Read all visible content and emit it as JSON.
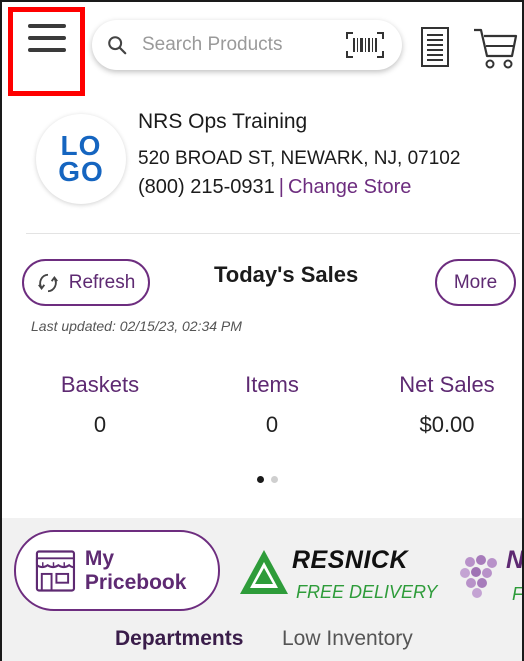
{
  "header": {
    "search": {
      "placeholder": "Search Products"
    }
  },
  "store": {
    "logo": {
      "line1": "LO",
      "line2": "GO"
    },
    "name": "NRS Ops Training",
    "address": "520 BROAD ST,  NEWARK,  NJ, 07102",
    "phone": "(800) 215-0931",
    "divider": "|",
    "change_store_label": "Change Store"
  },
  "sales": {
    "refresh_label": "Refresh",
    "title": "Today's Sales",
    "more_label": "More",
    "last_updated": "Last updated:  02/15/23, 02:34 PM",
    "stats": [
      {
        "label": "Baskets",
        "value": "0"
      },
      {
        "label": "Items",
        "value": "0"
      },
      {
        "label": "Net Sales",
        "value": "$0.00"
      }
    ],
    "carousel": {
      "pages": 2,
      "active": 1
    }
  },
  "shortcuts": {
    "pricebook_label": "My Pricebook",
    "resnick": {
      "name": "RESNICK",
      "tagline": "FREE DELIVERY"
    },
    "partial_brand": {
      "name": "N",
      "tagline": "F"
    }
  },
  "tabs": [
    {
      "label": "Departments",
      "active": true
    },
    {
      "label": "Low Inventory",
      "active": false
    }
  ],
  "colors": {
    "accent": "#6d2d7f",
    "highlight_border": "#ff0000",
    "brand_green": "#2e9c3a",
    "logo_blue": "#1565c0"
  }
}
